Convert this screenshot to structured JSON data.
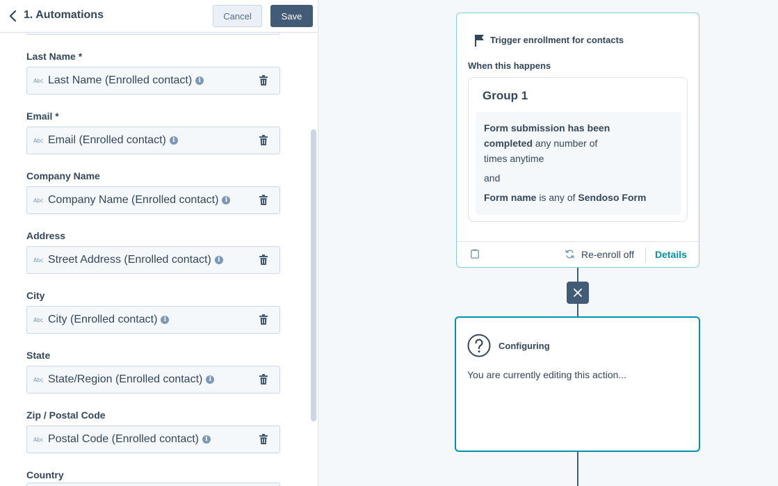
{
  "header": {
    "title": "1. Automations",
    "cancel_label": "Cancel",
    "save_label": "Save"
  },
  "fields": [
    {
      "label": "Last Name *",
      "value": "Last Name (Enrolled contact)",
      "icon": "abc-text-icon"
    },
    {
      "label": "Email *",
      "value": "Email (Enrolled contact)",
      "icon": "abc-text-icon"
    },
    {
      "label": "Company Name",
      "value": "Company Name (Enrolled contact)",
      "icon": "abc-text-icon"
    },
    {
      "label": "Address",
      "value": "Street Address (Enrolled contact)",
      "icon": "abc-text-icon"
    },
    {
      "label": "City",
      "value": "City (Enrolled contact)",
      "icon": "abc-text-icon"
    },
    {
      "label": "State",
      "value": "State/Region (Enrolled contact)",
      "icon": "abc-text-icon"
    },
    {
      "label": "Zip / Postal Code",
      "value": "Postal Code (Enrolled contact)",
      "icon": "abc-text-icon"
    },
    {
      "label": "Country",
      "value": "",
      "icon": "abc-text-icon"
    }
  ],
  "abc_glyph": "Abc",
  "info_glyph": "i",
  "trigger": {
    "title": "Trigger enrollment for contacts",
    "when_label": "When this happens",
    "group_title": "Group 1",
    "criteria": {
      "line1_bold": "Form submission has been",
      "line2_bold": "completed",
      "line2_rest": " any number of",
      "line3": "times anytime",
      "and": "and",
      "line5_bold1": "Form name",
      "line5_mid": " is any of ",
      "line5_bold2": "Sendoso Form"
    },
    "reenroll": "Re-enroll off",
    "details": "Details"
  },
  "config": {
    "title": "Configuring",
    "text": "You are currently editing this action..."
  },
  "colors": {
    "accent": "#0091ae",
    "dark": "#425b76",
    "text": "#33475b",
    "border_light": "#7fd1de"
  }
}
